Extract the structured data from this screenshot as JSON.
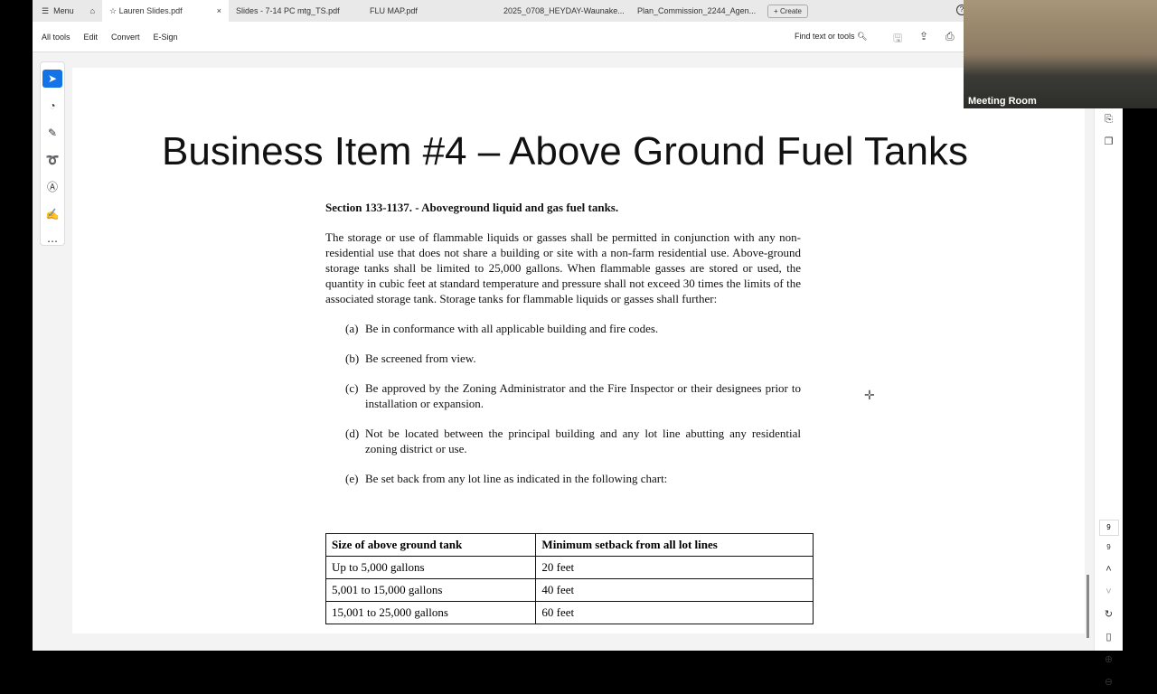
{
  "tabbar": {
    "menu": "Menu",
    "tabs": [
      "Lauren Slides.pdf",
      "Slides - 7-14 PC mtg_TS.pdf",
      "FLU MAP.pdf",
      "2025_0708_HEYDAY-Waunake...",
      "Plan_Commission_2244_Agen..."
    ],
    "create": "Create",
    "help": "?"
  },
  "toolbar": {
    "items": [
      "All tools",
      "Edit",
      "Convert",
      "E-Sign"
    ],
    "find": "Find text or tools"
  },
  "slide": {
    "title": "Business Item #4 – Above Ground Fuel Tanks",
    "section": "Section 133-1137. - Aboveground liquid and gas fuel tanks.",
    "paragraph": "The storage or use of flammable liquids or gasses shall be permitted in conjunction with any non-residential use that does not share a building or site with a non-farm residential use. Above-ground storage tanks shall be limited to 25,000 gallons. When flammable gasses are stored or used, the quantity in cubic feet at standard temperature and pressure shall not exceed 30 times the limits of the associated storage tank. Storage tanks for flammable liquids or gasses shall further:",
    "items": [
      {
        "label": "(a)",
        "text": "Be in conformance with all applicable building and fire codes."
      },
      {
        "label": "(b)",
        "text": "Be screened from view."
      },
      {
        "label": "(c)",
        "text": "Be approved by the Zoning Administrator and the Fire Inspector or their designees prior to installation or expansion."
      },
      {
        "label": "(d)",
        "text": "Not be located between the principal building and any lot line abutting any residential zoning district or use."
      },
      {
        "label": "(e)",
        "text": "Be set back from any lot line as indicated in the following chart:"
      }
    ],
    "table": {
      "headers": [
        "Size of above ground tank",
        "Minimum setback from all lot lines"
      ],
      "rows": [
        [
          "Up to 5,000 gallons",
          "20 feet"
        ],
        [
          "5,001 to 15,000 gallons",
          "40 feet"
        ],
        [
          "15,001 to 25,000 gallons",
          "60 feet"
        ]
      ]
    }
  },
  "nav": {
    "page_current": "9",
    "page_total": "9"
  },
  "video": {
    "label": "Meeting Room"
  }
}
